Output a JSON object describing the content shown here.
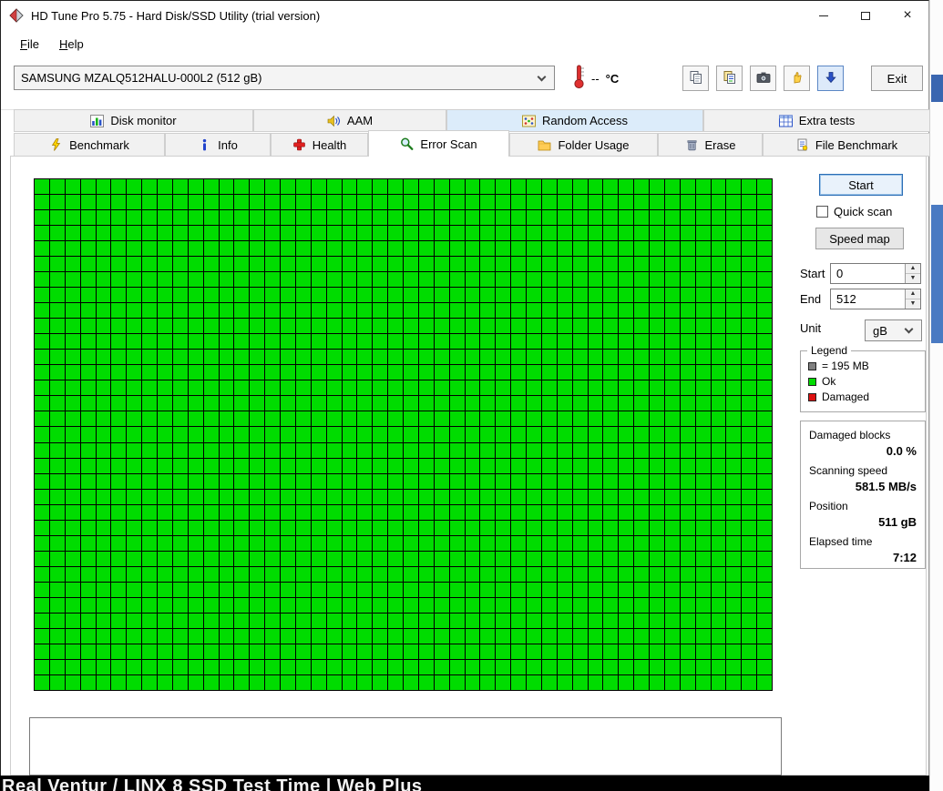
{
  "window": {
    "title": "HD Tune Pro 5.75 - Hard Disk/SSD Utility (trial version)"
  },
  "menu": {
    "file": "File",
    "help": "Help"
  },
  "toolbar": {
    "drive_selector": "SAMSUNG MZALQ512HALU-000L2 (512 gB)",
    "temperature_value": "--",
    "temperature_unit": "°C",
    "exit_label": "Exit"
  },
  "tabs": {
    "row1": [
      {
        "label": "Disk monitor"
      },
      {
        "label": "AAM"
      },
      {
        "label": "Random Access"
      },
      {
        "label": "Extra tests"
      }
    ],
    "row2": [
      {
        "label": "Benchmark"
      },
      {
        "label": "Info"
      },
      {
        "label": "Health"
      },
      {
        "label": "Error Scan"
      },
      {
        "label": "Folder Usage"
      },
      {
        "label": "Erase"
      },
      {
        "label": "File Benchmark"
      }
    ],
    "active": "Error Scan"
  },
  "error_scan": {
    "start_button": "Start",
    "quick_scan": {
      "label": "Quick scan",
      "checked": false
    },
    "speed_map_button": "Speed map",
    "range": {
      "start_label": "Start",
      "start_value": "0",
      "end_label": "End",
      "end_value": "512",
      "unit_label": "Unit",
      "unit_value": "gB"
    },
    "legend": {
      "title": "Legend",
      "block_label": "= 195 MB",
      "ok_label": "Ok",
      "damaged_label": "Damaged",
      "block_color": "#808080",
      "ok_color": "#00dc00",
      "damaged_color": "#dd1111"
    },
    "stats": [
      {
        "label": "Damaged blocks",
        "value": "0.0 %"
      },
      {
        "label": "Scanning speed",
        "value": "581.5 MB/s"
      },
      {
        "label": "Position",
        "value": "511 gB"
      },
      {
        "label": "Elapsed time",
        "value": "7:12"
      }
    ],
    "grid": {
      "cols": 48,
      "rows": 33,
      "ok_color": "#00dc00",
      "line_color": "#000000",
      "all_blocks_status": "ok"
    }
  },
  "background_page": {
    "partial_text": "Real Ventur / LINX 8 SSD Test Time | Web Plus"
  }
}
